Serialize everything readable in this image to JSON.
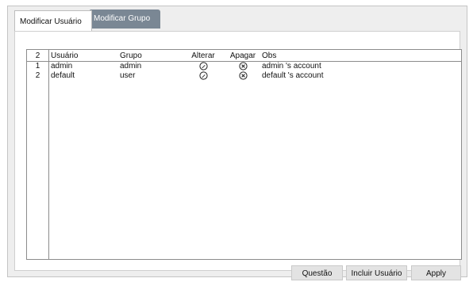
{
  "tabs": [
    {
      "label": "Modificar Usuário",
      "active": true
    },
    {
      "label": "Modificar Grupo",
      "active": false
    }
  ],
  "table": {
    "headers": {
      "count": "2",
      "user": "Usuário",
      "group": "Grupo",
      "edit": "Alterar",
      "delete": "Apagar",
      "obs": "Obs"
    },
    "rows": [
      {
        "index": "1",
        "user": "admin",
        "group": "admin",
        "obs": "admin 's account"
      },
      {
        "index": "2",
        "user": "default",
        "group": "user",
        "obs": "default 's account"
      }
    ]
  },
  "icons": {
    "edit": "pencil-circle-icon",
    "delete": "close-circle-icon"
  },
  "buttons": {
    "question": "Questão",
    "add_user": "Incluir Usuário",
    "apply": "Apply"
  },
  "colors": {
    "inactive_tab": "#7a8794",
    "frame_bg": "#eeeeee",
    "button_bg": "#e3e3e3"
  }
}
